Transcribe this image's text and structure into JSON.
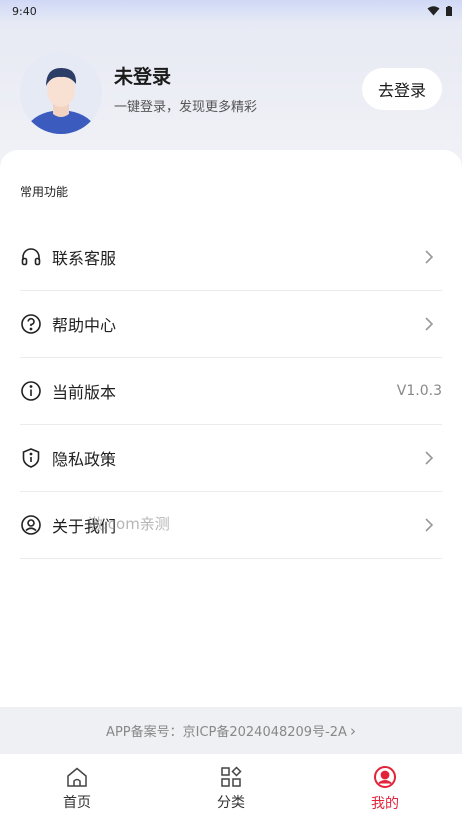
{
  "status_bar": {
    "time": "9:40"
  },
  "profile": {
    "name": "未登录",
    "subtitle": "一键登录，发现更多精彩",
    "login_label": "去登录"
  },
  "section": {
    "title": "常用功能"
  },
  "menu": [
    {
      "label": "联系客服",
      "icon": "headset-icon",
      "value": ""
    },
    {
      "label": "帮助中心",
      "icon": "help-circle-icon",
      "value": ""
    },
    {
      "label": "当前版本",
      "icon": "info-circle-icon",
      "value": "V1.0.3"
    },
    {
      "label": "隐私政策",
      "icon": "shield-info-icon",
      "value": ""
    },
    {
      "label": "关于我们",
      "icon": "user-circle-icon",
      "value": ""
    }
  ],
  "watermark": "激.com亲测",
  "beian": {
    "text": "APP备案号：京ICP备2024048209号-2A",
    "arrow": "›"
  },
  "tabs": [
    {
      "label": "首页",
      "icon": "home-icon",
      "active": false
    },
    {
      "label": "分类",
      "icon": "category-icon",
      "active": false
    },
    {
      "label": "我的",
      "icon": "profile-icon",
      "active": true
    }
  ],
  "colors": {
    "accent": "#e2233a",
    "avatar_shirt": "#3b5bbf"
  }
}
